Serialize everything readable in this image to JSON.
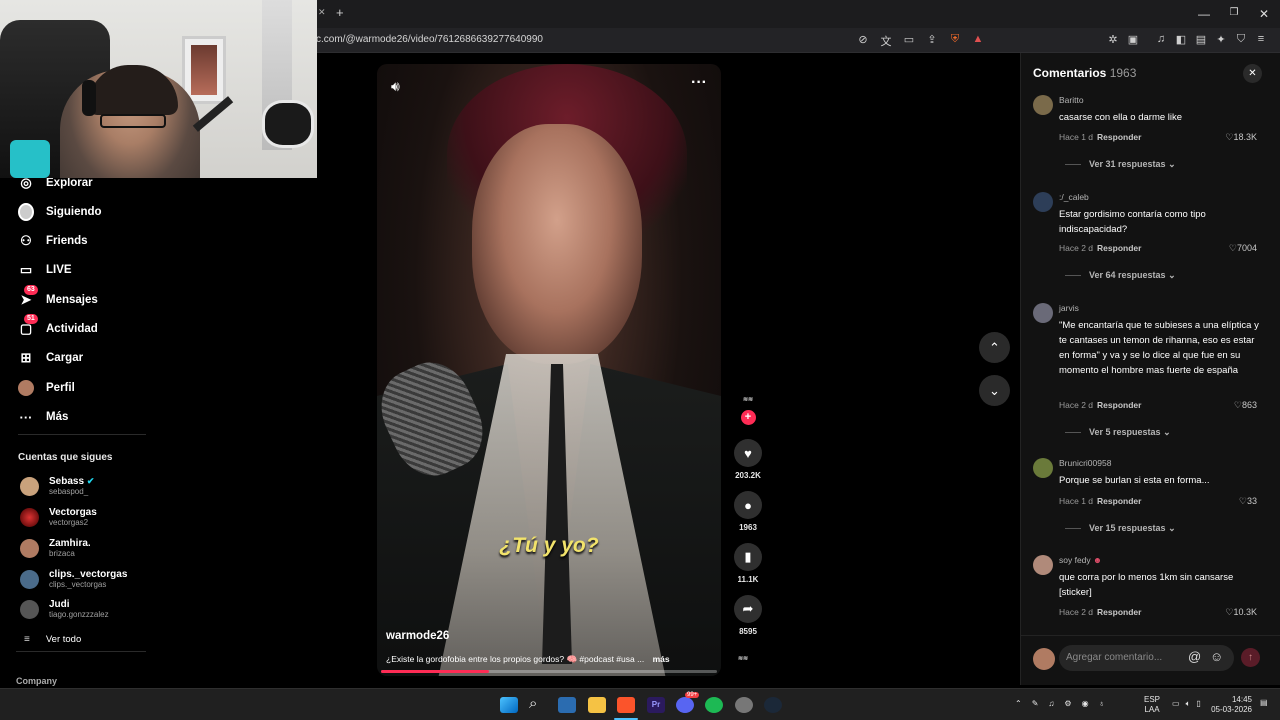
{
  "browser": {
    "url": "c.com/@warmode26/video/7612686639277640990",
    "new_tab_symbol": "+"
  },
  "sidebar": {
    "items": [
      {
        "label": "Explorar"
      },
      {
        "label": "Siguiendo"
      },
      {
        "label": "Friends"
      },
      {
        "label": "LIVE"
      },
      {
        "label": "Mensajes",
        "badge": "63"
      },
      {
        "label": "Actividad",
        "badge": "51"
      },
      {
        "label": "Cargar"
      },
      {
        "label": "Perfil"
      },
      {
        "label": "Más"
      }
    ],
    "following_title": "Cuentas que sigues",
    "accounts": [
      {
        "name": "Sebass",
        "handle": "sebaspod_",
        "color": "#c9a27c"
      },
      {
        "name": "Vectorgas",
        "handle": "vectorgas2",
        "color": "#a22"
      },
      {
        "name": "Zamhira.",
        "handle": "brizaca",
        "color": "#b07b62"
      },
      {
        "name": "clips._vectorgas",
        "handle": "clips._vectorgas",
        "color": "#4a6b8a"
      },
      {
        "name": "Judi",
        "handle": "tiago.gonzzzalez",
        "color": "#555"
      }
    ],
    "see_all": "Ver todo",
    "footer": "Company"
  },
  "video": {
    "subtitle": "¿Tú y yo?",
    "author": "warmode26",
    "description": "¿Existe la gordofobia entre los propios gordos? 🧠 #podcast #usa ...",
    "more": "más",
    "progress": 0.32
  },
  "actions": {
    "likes": "203.2K",
    "comments": "1963",
    "saves": "11.1K",
    "shares": "8595"
  },
  "comments_panel": {
    "title": "Comentarios",
    "count": "1963",
    "reply_label": "Responder",
    "input_placeholder": "Agregar comentario...",
    "comments": [
      {
        "user": "Baritto",
        "text": "casarse con ella o darme like",
        "time": "Hace 1 d",
        "likes": "18.3K",
        "more": "Ver 31 respuestas",
        "color": "#7a6a4a"
      },
      {
        "user": ":/_caleb",
        "text": "Estar gordisimo contaría como tipo indiscapacidad?",
        "time": "Hace 2 d",
        "likes": "7004",
        "more": "Ver 64 respuestas",
        "color": "#2d3e58"
      },
      {
        "user": "jarvis",
        "text": "\"Me encantaría que te subieses a una elíptica y te cantases un temon de rihanna, eso es estar en forma\" y va y se lo dice al que fue en su momento el hombre mas fuerte de españa",
        "time": "Hace 2 d",
        "likes": "863",
        "more": "Ver 5 respuestas",
        "color": "#6a6a78"
      },
      {
        "user": "Brunicri00958",
        "text": "Porque se burlan si esta en forma...",
        "time": "Hace 1 d",
        "likes": "33",
        "more": "Ver 15 respuestas",
        "color": "#6a7a3a"
      },
      {
        "user": "soy fedy",
        "text": "que corra por lo menos 1km sin cansarse [sticker]",
        "time": "Hace 2 d",
        "likes": "10.3K",
        "more": "",
        "color": "#b08a7a"
      }
    ]
  },
  "taskbar": {
    "lang": "ESP",
    "lang2": "LAA",
    "time": "14:45",
    "date": "05-03-2026",
    "discord_badge": "99+"
  },
  "colors": {
    "accent": "#fe2c55",
    "subtitle": "#f2e36b"
  }
}
